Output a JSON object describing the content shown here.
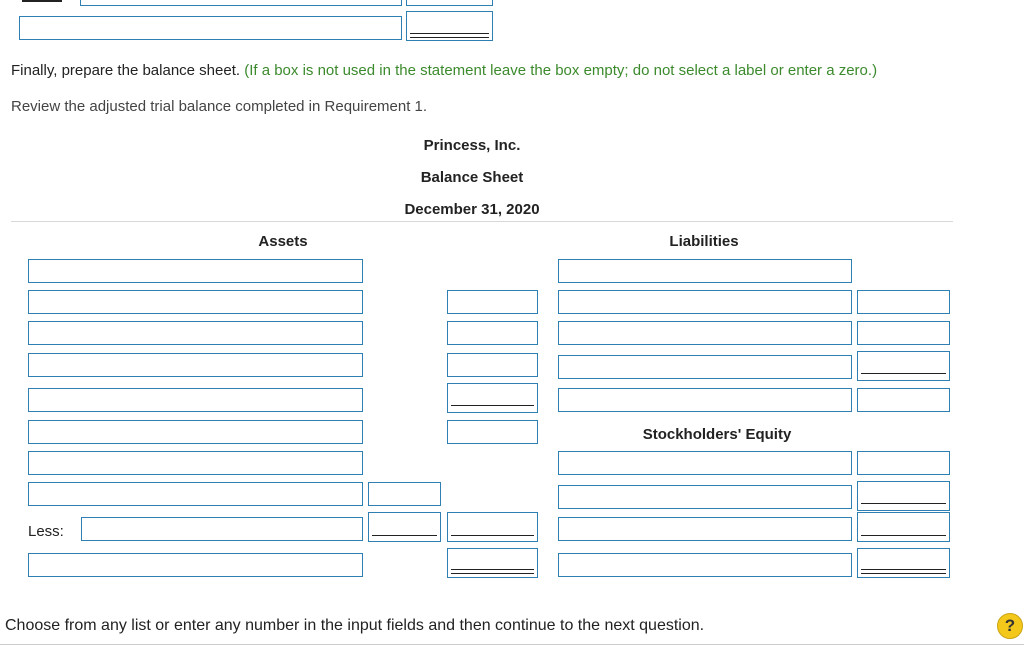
{
  "prompt": {
    "instruction": "Finally, prepare the balance sheet.",
    "hint": "(If a box is not used in the statement leave the box empty; do not select a label or enter a zero.)",
    "review": "Review the adjusted trial balance completed in Requirement 1."
  },
  "statement": {
    "company": "Princess, Inc.",
    "title": "Balance Sheet",
    "date": "December 31, 2020"
  },
  "sections": {
    "assets": "Assets",
    "liabilities": "Liabilities",
    "equity": "Stockholders' Equity"
  },
  "labels": {
    "less": "Less:"
  },
  "footer": {
    "message": "Choose from any list or enter any number in the input fields and then continue to the next question.",
    "help_icon": "question-icon",
    "help_glyph": "?"
  }
}
